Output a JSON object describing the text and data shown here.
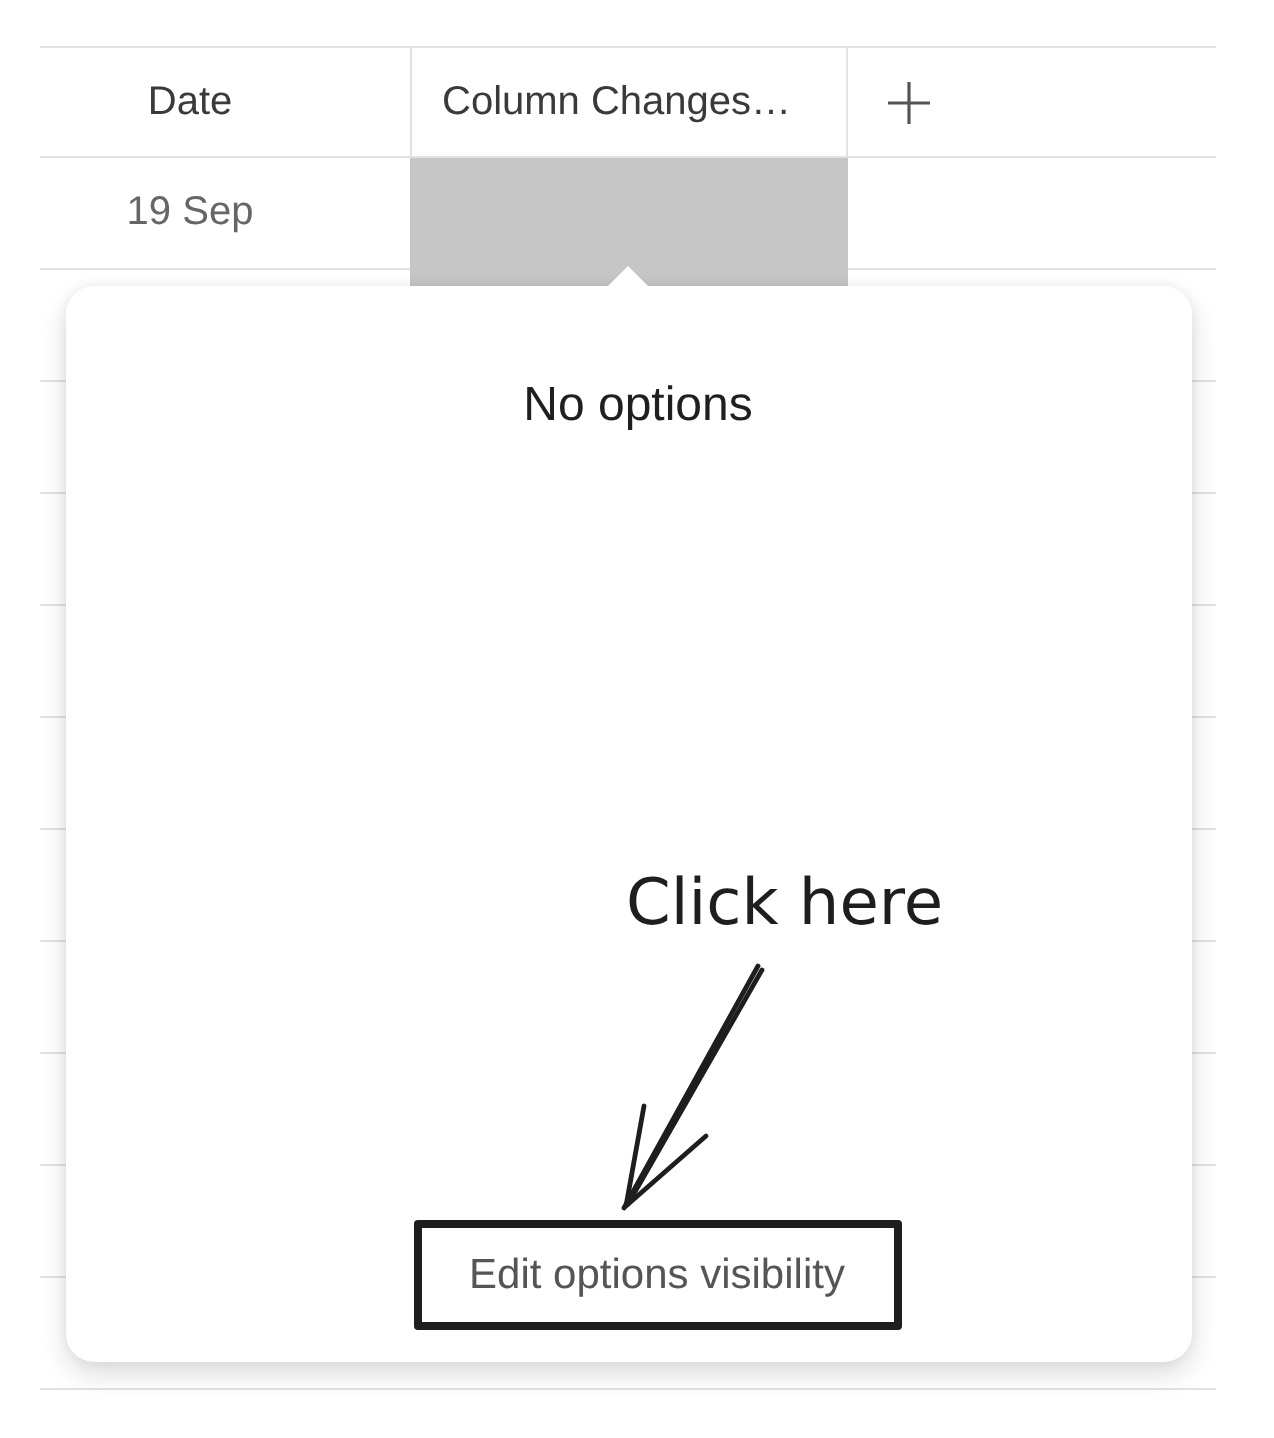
{
  "table": {
    "columns": [
      {
        "label": "Date",
        "selected": false
      },
      {
        "label": "Column Changes…",
        "selected": true
      }
    ],
    "rows": [
      {
        "cells": [
          {
            "text": "19 Sep",
            "selected": false
          },
          {
            "selected": true
          }
        ]
      }
    ]
  },
  "dropdown": {
    "message": "No options",
    "button": "Edit options visibility"
  },
  "annotation": {
    "text": "Click here"
  }
}
